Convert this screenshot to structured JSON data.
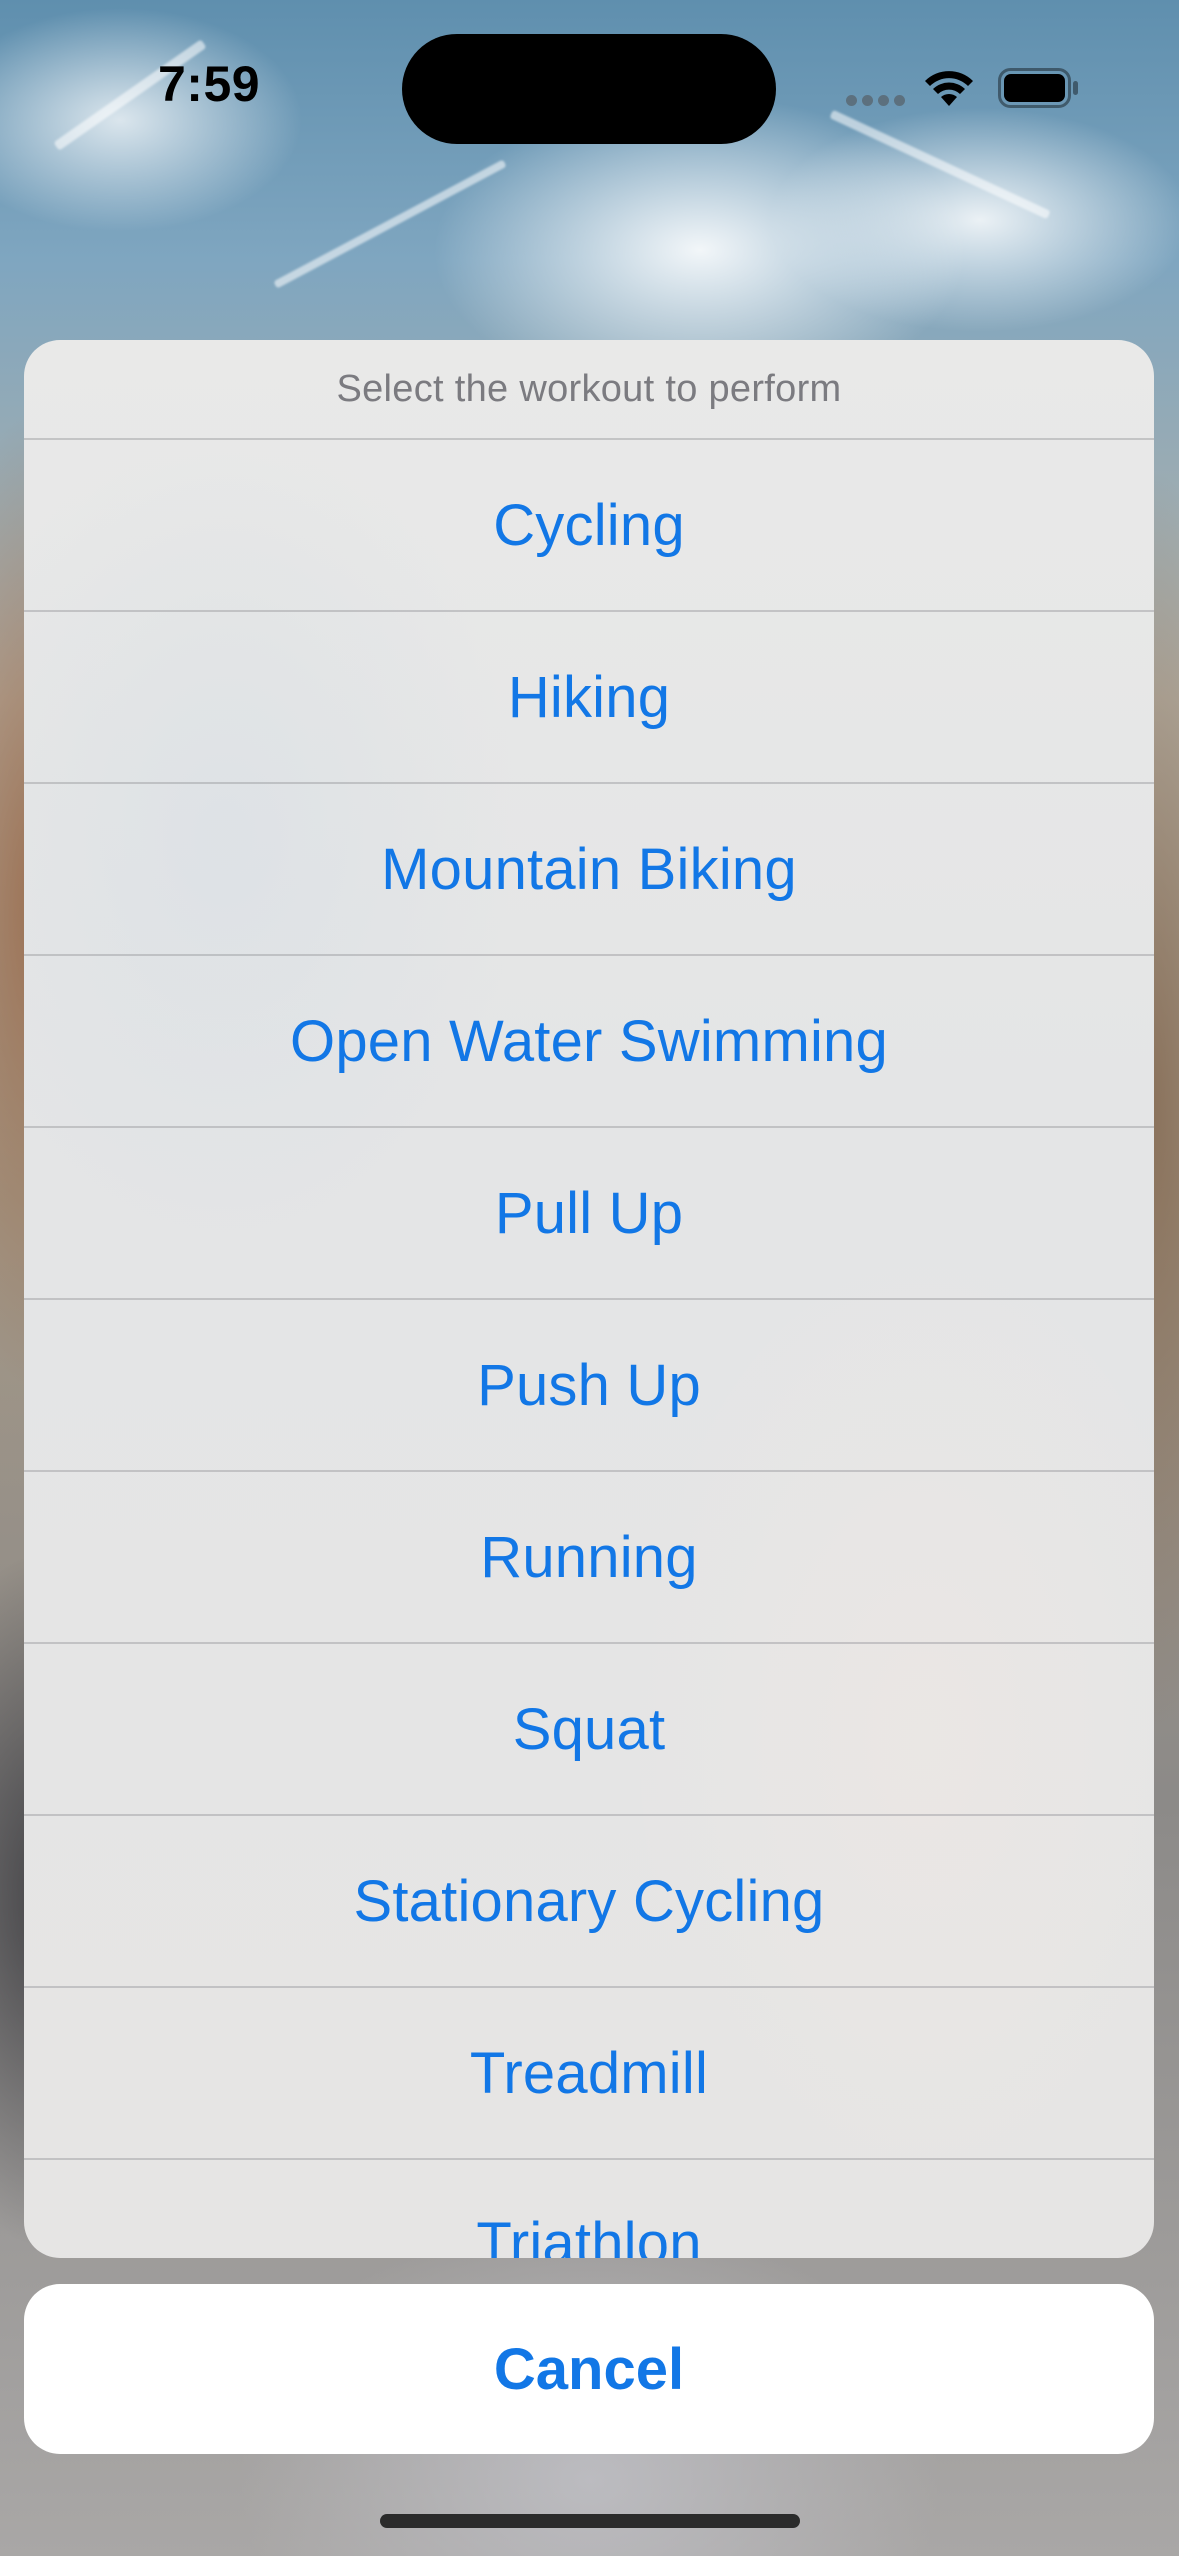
{
  "status_bar": {
    "time": "7:59"
  },
  "action_sheet": {
    "message": "Select the workout to perform",
    "options": [
      "Cycling",
      "Hiking",
      "Mountain Biking",
      "Open Water Swimming",
      "Pull Up",
      "Push Up",
      "Running",
      "Squat",
      "Stationary Cycling",
      "Treadmill",
      "Triathlon"
    ],
    "cancel_label": "Cancel"
  },
  "colors": {
    "accent": "#1277e6",
    "sheet_background": "#e6e6e6",
    "cancel_background": "#ffffff"
  },
  "icons": [
    "cellular-signal-icon",
    "wifi-icon",
    "battery-icon"
  ]
}
